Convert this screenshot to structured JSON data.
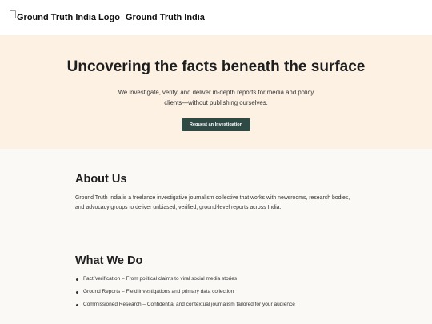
{
  "header": {
    "logo_alt": "Ground Truth India Logo",
    "site_name": "Ground Truth India"
  },
  "hero": {
    "title": "Uncovering the facts beneath the surface",
    "subtitle": "We investigate, verify, and deliver in-depth reports for media and policy clients—without publishing ourselves.",
    "cta_label": "Request an Investigation"
  },
  "about": {
    "heading": "About Us",
    "body": "Ground Truth India is a freelance investigative journalism collective that works with newsrooms, research bodies, and advocacy groups to deliver unbiased, verified, ground-level reports across India."
  },
  "services": {
    "heading": "What We Do",
    "items": [
      "Fact Verification – From political claims to viral social media stories",
      "Ground Reports – Field investigations and primary data collection",
      "Commissioned Research – Confidential and contextual journalism tailored for your audience"
    ]
  },
  "colors": {
    "hero_bg": "#fdf1e4",
    "cta_bg": "#2f4a44",
    "page_bg": "#fbf9f6"
  }
}
